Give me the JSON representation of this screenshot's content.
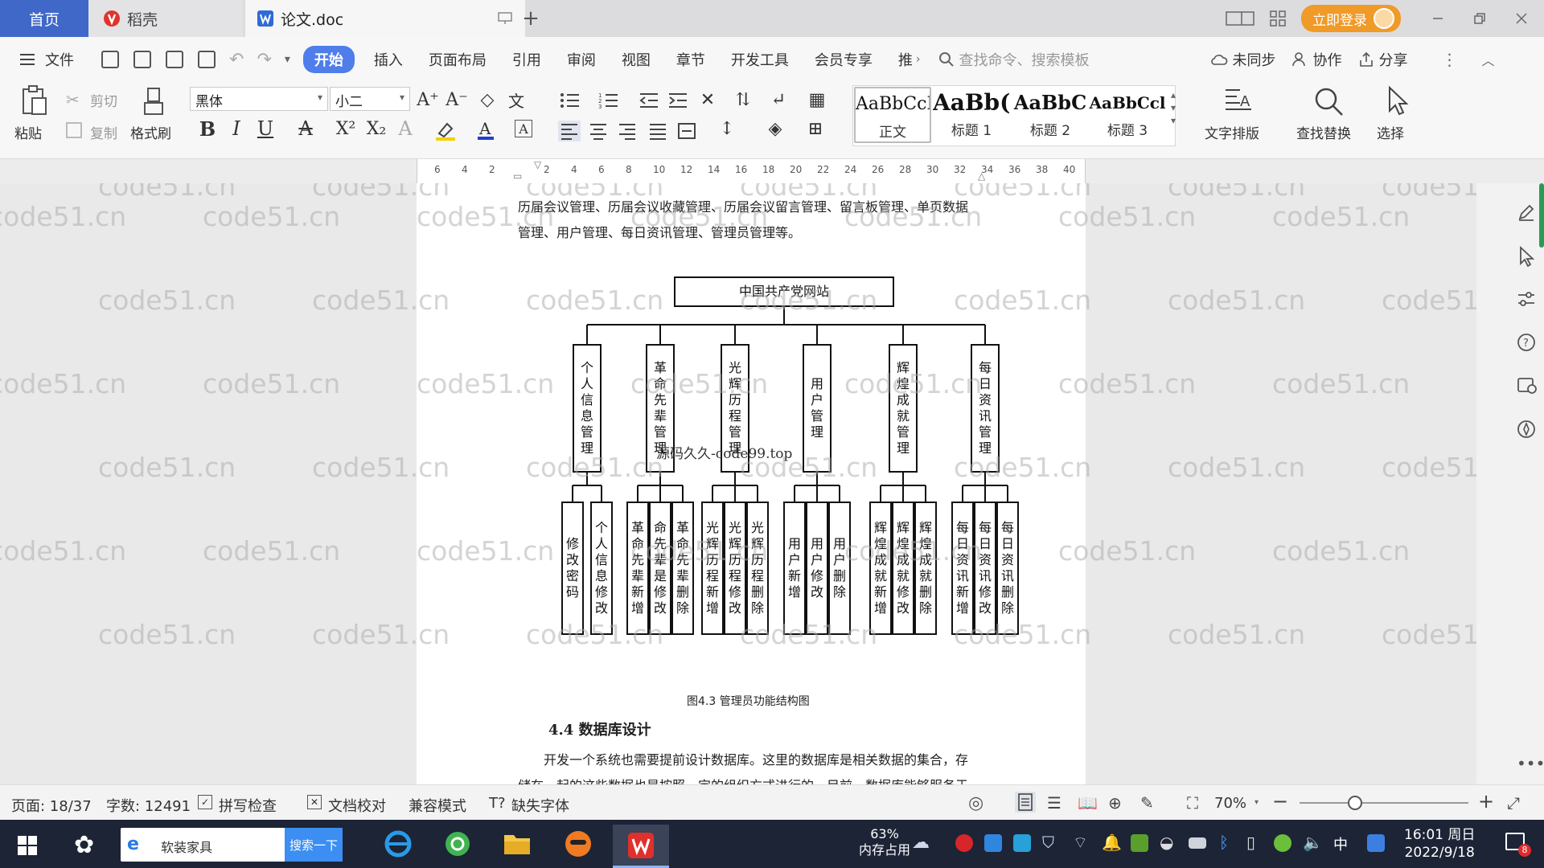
{
  "titlebar": {
    "tabs": [
      {
        "label": "首页",
        "icon": "home-tab"
      },
      {
        "label": "稻壳",
        "icon": "daoke-logo-icon"
      },
      {
        "label": "论文.doc",
        "icon": "wps-writer-icon"
      }
    ],
    "login_label": "立即登录"
  },
  "menubar": {
    "items": [
      "文件",
      "开始",
      "插入",
      "页面布局",
      "引用",
      "审阅",
      "视图",
      "章节",
      "开发工具",
      "会员专享",
      "推"
    ],
    "active": "开始",
    "search_placeholder": "查找命令、搜索模板",
    "right": [
      "未同步",
      "协作",
      "分享"
    ]
  },
  "ribbon": {
    "paste": "粘贴",
    "cut": "剪切",
    "copy": "复制",
    "format_painter": "格式刷",
    "font_name": "黑体",
    "font_size": "小二",
    "styles": [
      {
        "sample": "AaBbCcI",
        "label": "正文"
      },
      {
        "sample": "AaBb(",
        "label": "标题 1"
      },
      {
        "sample": "AaBbC",
        "label": "标题 2"
      },
      {
        "sample": "AaBbCcl",
        "label": "标题 3"
      }
    ],
    "text_layout": "文字排版",
    "find_replace": "查找替换",
    "select": "选择"
  },
  "ruler": {
    "ticks": [
      "6",
      "4",
      "2",
      "",
      "2",
      "4",
      "6",
      "8",
      "10",
      "12",
      "14",
      "16",
      "18",
      "20",
      "22",
      "24",
      "26",
      "28",
      "30",
      "32",
      "34",
      "36",
      "38",
      "40"
    ]
  },
  "document": {
    "para1_line1": "历届会议管理、历届会议收藏管理、历届会议留言管理、留言板管理、单页数据",
    "para1_line2": "管理、用户管理、每日资讯管理、管理员管理等。",
    "chart": {
      "root": "中国共产党网站",
      "branches": [
        {
          "label": "个人信息管理",
          "children": [
            "修改密码",
            "个人信息修改"
          ]
        },
        {
          "label": "革命先辈管理",
          "children": [
            "革命先辈新增",
            "命先辈是修改",
            "革命先辈删除"
          ]
        },
        {
          "label": "光辉历程管理",
          "children": [
            "光辉历程新增",
            "光辉历程修改",
            "光辉历程删除"
          ]
        },
        {
          "label": "用户管理",
          "children": [
            "用户新增",
            "用户修改",
            "用户删除"
          ]
        },
        {
          "label": "辉煌成就管理",
          "children": [
            "辉煌成就新增",
            "辉煌成就修改",
            "辉煌成就删除"
          ]
        },
        {
          "label": "每日资讯管理",
          "children": [
            "每日资讯新增",
            "每日资讯修改",
            "每日资讯删除"
          ]
        }
      ],
      "overlay": "源码久久-code99.top",
      "caption": "图4.3 管理员功能结构图"
    },
    "heading": "4.4  数据库设计",
    "para2_line1": "开发一个系统也需要提前设计数据库。这里的数据库是相关数据的集合，存",
    "para2_line2": "储在一起的这些数据也是按照一定的组织方式进行的。目前，数据库能够服务于",
    "watermark": "code51.cn"
  },
  "statusbar": {
    "page": "页面: 18/37",
    "words": "字数: 12491",
    "spellcheck": "拼写检查",
    "doc_check": "文档校对",
    "compat": "兼容模式",
    "missing_font": "缺失字体",
    "zoom": "70%"
  },
  "taskbar": {
    "search_text": "软装家具",
    "search_button": "搜索一下",
    "memory_percent": "63%",
    "memory_label": "内存占用",
    "time": "16:01 周日",
    "date": "2022/9/18",
    "ime": "中",
    "notification_count": "8"
  }
}
